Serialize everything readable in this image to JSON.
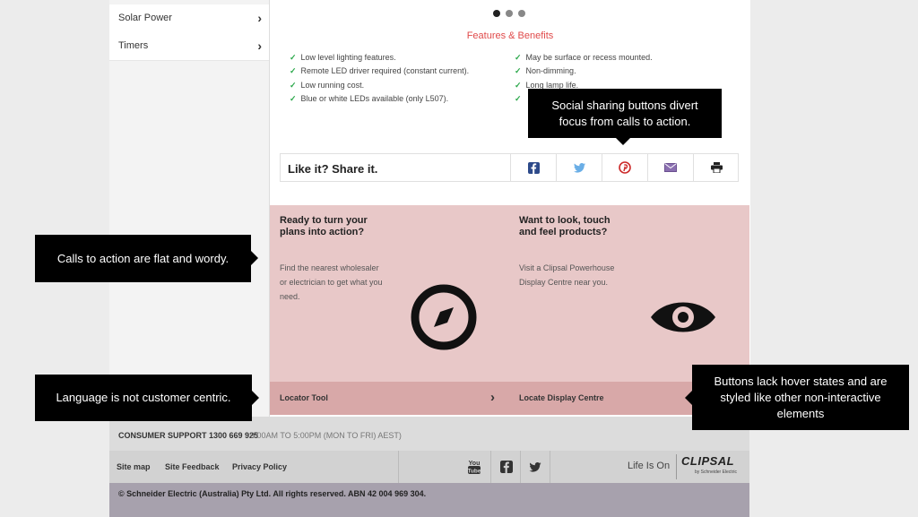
{
  "sidebar": {
    "items": [
      {
        "label": "Solar Power",
        "chevron": "›"
      },
      {
        "label": "Timers",
        "chevron": "›"
      }
    ]
  },
  "carousel": {
    "dots": 3,
    "active": 1
  },
  "features": {
    "title": "Features & Benefits",
    "left": [
      "Low level lighting features.",
      "Remote LED driver required (constant current).",
      "Low running cost.",
      "Blue or white LEDs available (only L507)."
    ],
    "right": [
      "May be surface or recess mounted.",
      "Non-dimming.",
      "Long lamp life."
    ]
  },
  "share": {
    "label": "Like it? Share it.",
    "buttons": [
      "facebook-icon",
      "twitter-icon",
      "pinterest-icon",
      "email-icon",
      "print-icon"
    ]
  },
  "cta": {
    "left_heading": "Ready to turn your plans into action?",
    "left_body": "Find the nearest wholesaler or electrician to get what you need.",
    "left_icon": "compass-icon",
    "left_link": "Locator Tool",
    "right_heading": "Want to look, touch and feel products?",
    "right_body": "Visit a Clipsal Powerhouse Display Centre near you.",
    "right_icon": "eye-icon",
    "right_link": "Locate Display Centre",
    "link_chevron": "›"
  },
  "footer": {
    "support_label": "CONSUMER SUPPORT 1300 669 925",
    "support_hours": "9:00AM TO 5:00PM (MON TO FRI) AEST)",
    "links": [
      "Site map",
      "Site Feedback",
      "Privacy Policy"
    ],
    "social_icons": [
      "youtube-icon",
      "facebook-icon",
      "twitter-icon"
    ],
    "tagline": "Life Is On",
    "brand": "CLIPSAL",
    "brand_sub": "by Schneider Electric",
    "legal": "© Schneider Electric (Australia) Pty Ltd. All rights reserved. ABN 42 004 969 304."
  },
  "annotations": [
    "Social sharing buttons divert focus from calls to action.",
    "Calls to action are flat and wordy.",
    "Language is not customer centric.",
    "Buttons lack hover states and are styled like other non-interactive elements"
  ],
  "colors": {
    "accent_red": "#e04a4a",
    "check_green": "#2aa84a",
    "cta_bg": "#e8c8c8",
    "cta_bar": "#d8a8a8",
    "legal_bg": "#a7a1ad"
  }
}
